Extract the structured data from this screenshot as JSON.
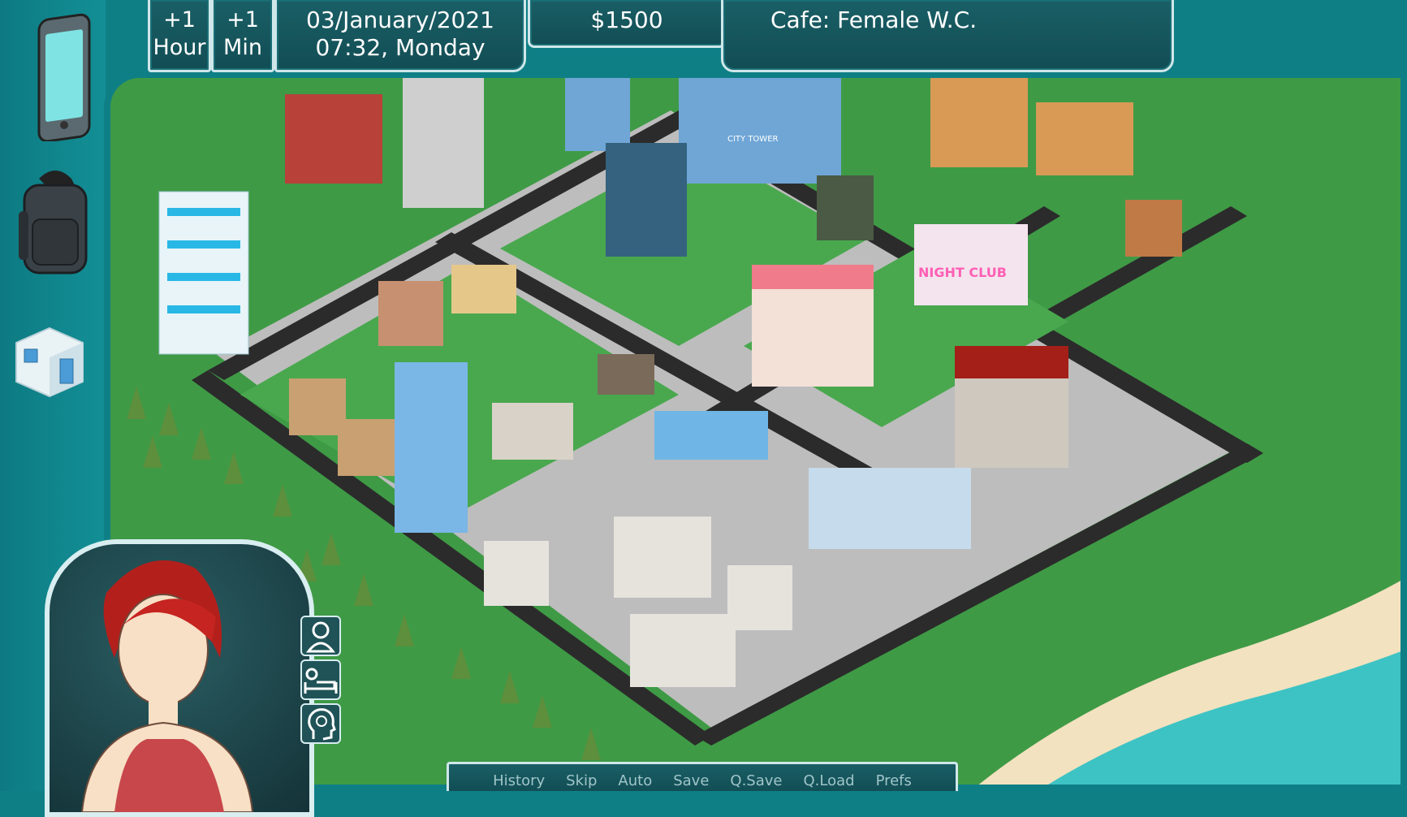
{
  "hud": {
    "plus_hour_line1": "+1",
    "plus_hour_line2": "Hour",
    "plus_min_line1": "+1",
    "plus_min_line2": "Min",
    "date": "03/January/2021",
    "time_day": "07:32, Monday",
    "money": "$1500",
    "location": "Cafe: Female W.C."
  },
  "sidebar": {
    "items": [
      {
        "icon": "phone-icon"
      },
      {
        "icon": "backpack-icon"
      },
      {
        "icon": "room-cube-icon"
      }
    ]
  },
  "status_icons": [
    "person-icon",
    "sleep-icon",
    "mind-icon"
  ],
  "quick_menu": [
    "History",
    "Skip",
    "Auto",
    "Save",
    "Q.Save",
    "Q.Load",
    "Prefs"
  ],
  "map_signs": {
    "nightclub": "NIGHT CLUB",
    "city_tower": "CITY TOWER"
  },
  "colors": {
    "panel": "#124d54",
    "teal_bg": "#0f7f86",
    "grass": "#3f9a46",
    "road": "#2b2b2b",
    "sea": "#3fc4c4",
    "sand": "#f4e3c0"
  }
}
